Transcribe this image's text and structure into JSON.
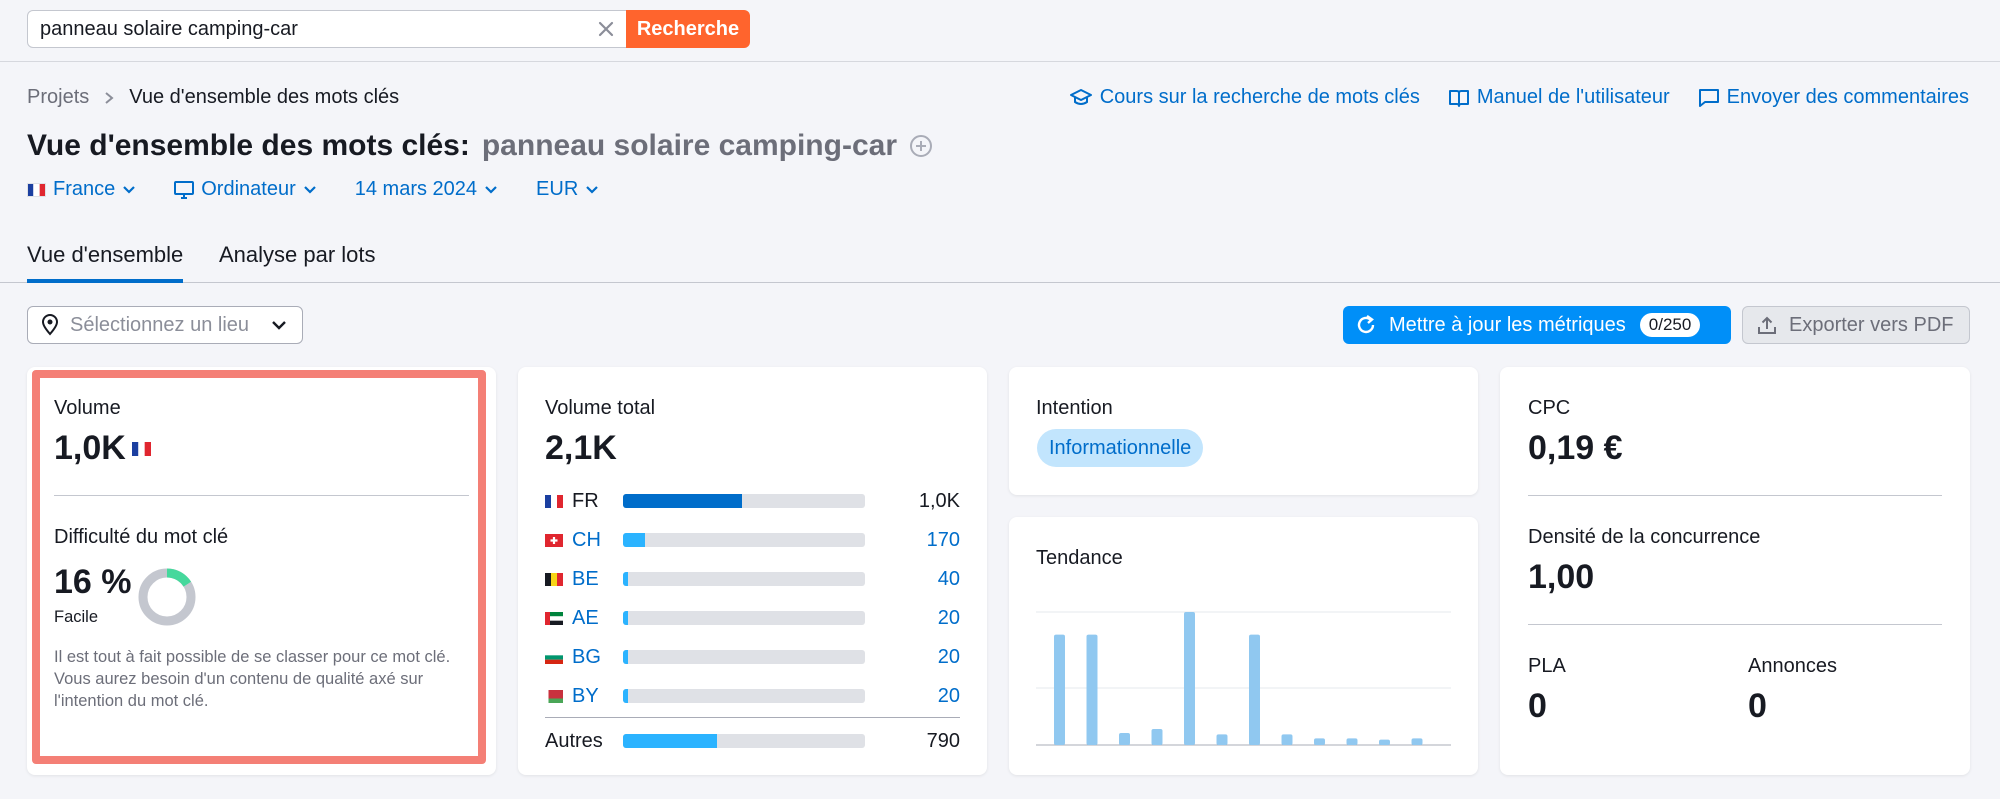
{
  "search": {
    "value": "panneau solaire camping-car",
    "button": "Recherche"
  },
  "breadcrumb": {
    "root": "Projets",
    "current": "Vue d'ensemble des mots clés"
  },
  "top_links": [
    {
      "label": "Cours sur la recherche de mots clés",
      "icon": "graduation-cap-icon"
    },
    {
      "label": "Manuel de l'utilisateur",
      "icon": "book-icon"
    },
    {
      "label": "Envoyer des commentaires",
      "icon": "chat-icon"
    }
  ],
  "page_title": {
    "prefix": "Vue d'ensemble des mots clés:",
    "keyword": "panneau solaire camping-car"
  },
  "filters": {
    "country": "France",
    "device": "Ordinateur",
    "date": "14 mars 2024",
    "currency": "EUR"
  },
  "tabs": [
    {
      "label": "Vue d'ensemble"
    },
    {
      "label": "Analyse par lots"
    }
  ],
  "location_select": {
    "placeholder": "Sélectionnez un lieu"
  },
  "update_button": {
    "label": "Mettre à jour les métriques",
    "count": "0/250"
  },
  "export_button": {
    "label": "Exporter vers PDF"
  },
  "volume_card": {
    "volume_label": "Volume",
    "volume_value": "1,0K",
    "difficulty_label": "Difficulté du mot clé",
    "difficulty_value": "16 %",
    "difficulty_percent": 16,
    "difficulty_level": "Facile",
    "description": "Il est tout à fait possible de se classer pour ce mot clé. Vous aurez besoin d'un contenu de qualité axé sur l'intention du mot clé."
  },
  "total_volume_card": {
    "label": "Volume total",
    "value": "2,1K",
    "countries": [
      {
        "code": "FR",
        "value": "1,0K",
        "share": 0.49,
        "link": false
      },
      {
        "code": "CH",
        "value": "170",
        "share": 0.09,
        "link": true
      },
      {
        "code": "BE",
        "value": "40",
        "share": 0.02,
        "link": true
      },
      {
        "code": "AE",
        "value": "20",
        "share": 0.02,
        "link": true
      },
      {
        "code": "BG",
        "value": "20",
        "share": 0.02,
        "link": true
      },
      {
        "code": "BY",
        "value": "20",
        "share": 0.02,
        "link": true
      }
    ],
    "others_label": "Autres",
    "others_value": "790",
    "others_share": 0.39
  },
  "intent_card": {
    "label": "Intention",
    "badge": "Informationnelle"
  },
  "trend_card": {
    "label": "Tendance",
    "chart_data": {
      "type": "bar",
      "values": [
        83,
        83,
        9,
        12,
        100,
        8,
        83,
        8,
        5,
        5,
        4,
        5
      ]
    }
  },
  "cpc_card": {
    "cpc_label": "CPC",
    "cpc_value": "0,19 €",
    "density_label": "Densité de la concurrence",
    "density_value": "1,00",
    "pla_label": "PLA",
    "pla_value": "0",
    "ads_label": "Annonces",
    "ads_value": "0"
  },
  "colors": {
    "accent": "#006dca",
    "primary_button": "#008ff8",
    "search_button": "#ff642d",
    "bar_fr": "#006dca",
    "bar_other": "#2bb3ff",
    "trend_bar": "#90c8f0",
    "highlight": "#f47f76"
  }
}
